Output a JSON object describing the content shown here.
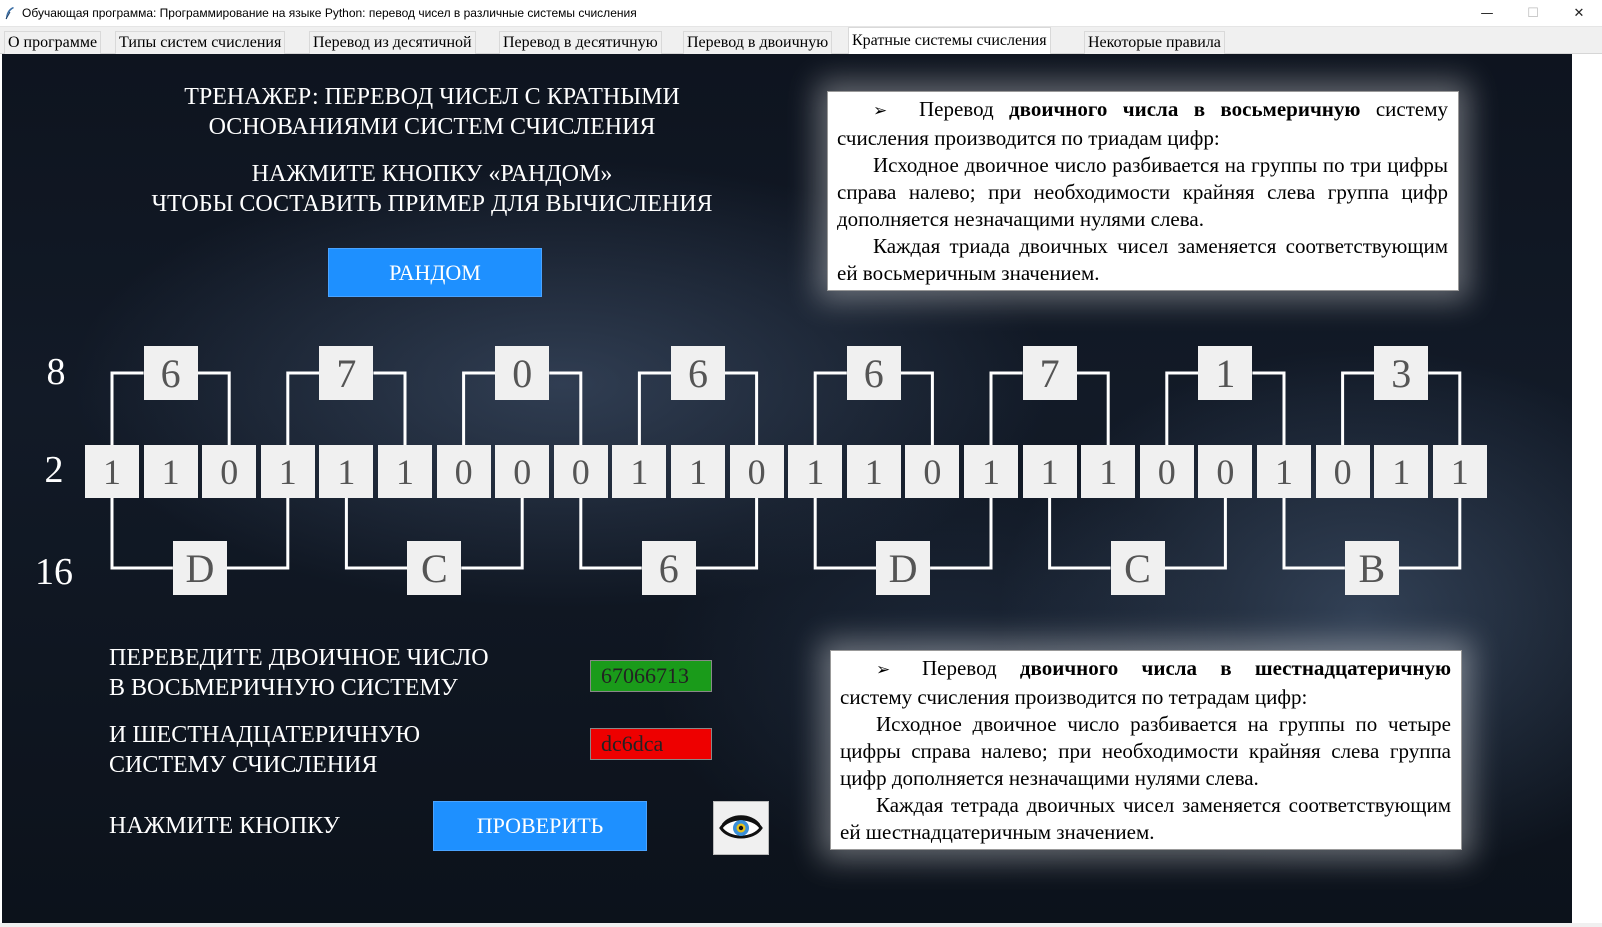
{
  "window": {
    "title": "Обучающая программа: Программирование на языке Python: перевод чисел в различные системы счисления",
    "icon": "feather-icon",
    "controls": [
      "minimize-icon",
      "maximize-icon",
      "close-icon"
    ]
  },
  "tabs": [
    {
      "label": "О программе",
      "active": false
    },
    {
      "label": "Типы систем счисления",
      "active": false
    },
    {
      "label": "Перевод из десятичной",
      "active": false
    },
    {
      "label": "Перевод в десятичную",
      "active": false
    },
    {
      "label": "Перевод в двоичную",
      "active": false
    },
    {
      "label": "Кратные системы счисления",
      "active": true
    },
    {
      "label": "Некоторые правила",
      "active": false
    }
  ],
  "trainer": {
    "title_line1": "ТРЕНАЖЕР: ПЕРЕВОД ЧИСЕЛ С КРАТНЫМИ",
    "title_line2": "ОСНОВАНИЯМИ СИСТЕМ СЧИСЛЕНИЯ",
    "hint_line1": "НАЖМИТЕ КНОПКУ «РАНДОМ»",
    "hint_line2": "ЧТОБЫ СОСТАВИТЬ ПРИМЕР ДЛЯ ВЫЧИСЛЕНИЯ",
    "random_button": "РАНДОМ"
  },
  "octal_rule": {
    "marker": "➢",
    "intro_plain": "Перевод ",
    "intro_bold": "двоичного числа в восьмеричную",
    "intro_rest": " систему счисления производится по триадам цифр:",
    "para2": "Исходное двоичное число разбивается на группы по три цифры справа налево; при необходимости крайняя слева группа цифр дополняется незначащими нулями слева.",
    "para3": "Каждая триада двоичных чисел заменяется соответствующим ей восьмеричным значением."
  },
  "hex_rule": {
    "marker": "➢",
    "intro_plain": "Перевод ",
    "intro_bold": "двоичного числа в шестнадцатеричную",
    "intro_rest": " систему счисления производится по тетрадам цифр:",
    "para2": "Исходное двоичное число разбивается на группы по четыре цифры справа налево; при необходимости крайняя слева группа цифр дополняется незначащими нулями слева.",
    "para3": "Каждая тетрада двоичных чисел заменяется соответствующим ей шестнадцатеричным значением."
  },
  "bases": {
    "octal": "8",
    "binary": "2",
    "hex": "16"
  },
  "binary_digits": [
    "1",
    "1",
    "0",
    "1",
    "1",
    "1",
    "0",
    "0",
    "0",
    "1",
    "1",
    "0",
    "1",
    "1",
    "0",
    "1",
    "1",
    "1",
    "0",
    "0",
    "1",
    "0",
    "1",
    "1"
  ],
  "octal_digits": [
    "6",
    "7",
    "0",
    "6",
    "6",
    "7",
    "1",
    "3"
  ],
  "hex_digits": [
    "D",
    "C",
    "6",
    "D",
    "C",
    "B"
  ],
  "task": {
    "line1": "ПЕРЕВЕДИТЕ ДВОИЧНОЕ ЧИСЛО",
    "line2": "В ВОСЬМЕРИЧНУЮ СИСТЕМУ",
    "line3": "И ШЕСТНАДЦАТЕРИЧНУЮ",
    "line4": "СИСТЕМУ СЧИСЛЕНИЯ",
    "press": "НАЖМИТЕ КНОПКУ",
    "check_button": "ПРОВЕРИТЬ",
    "show_answer_icon": "eye-icon"
  },
  "answers": {
    "octal": {
      "value": "67066713",
      "status": "correct",
      "color": "#1a9b1a"
    },
    "hex": {
      "value": "dc6dca",
      "status": "incorrect",
      "color": "#ee0000"
    }
  },
  "colors": {
    "button_blue": "#1e90ff",
    "background": "#0f1622",
    "digit_box": "#f0f0f0"
  }
}
